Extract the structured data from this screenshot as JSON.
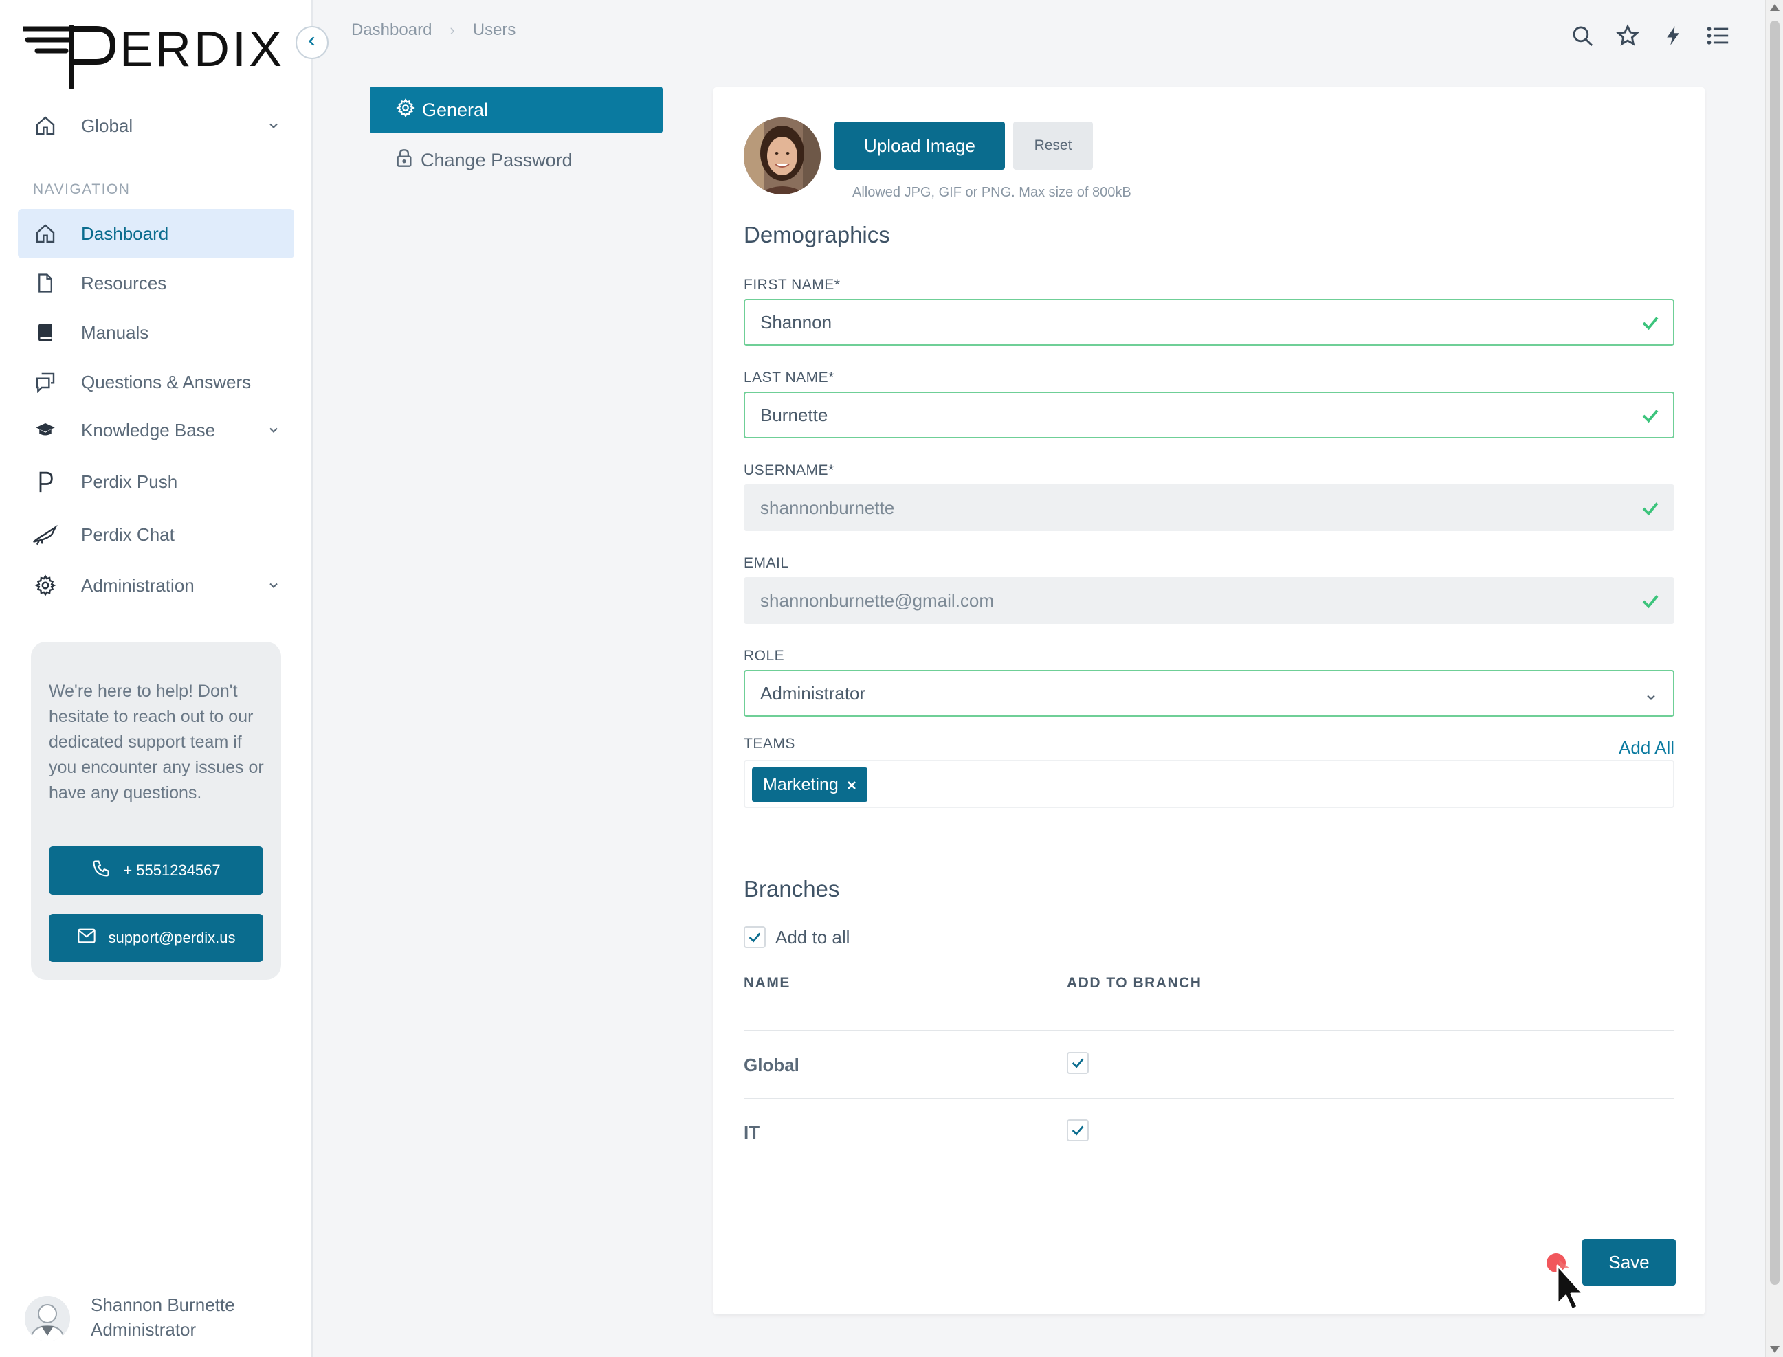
{
  "brand": {
    "logo_text": "PERDIX"
  },
  "sidebar": {
    "scope": {
      "label": "Global"
    },
    "nav_heading": "NAVIGATION",
    "items": [
      {
        "label": "Dashboard",
        "icon": "home-icon",
        "active": true
      },
      {
        "label": "Resources",
        "icon": "file-icon"
      },
      {
        "label": "Manuals",
        "icon": "book-icon"
      },
      {
        "label": "Questions & Answers",
        "icon": "chat-icon"
      },
      {
        "label": "Knowledge Base",
        "icon": "graduation-cap-icon",
        "expandable": true
      },
      {
        "label": "Perdix Push",
        "icon": "perdix-push-icon"
      },
      {
        "label": "Perdix Chat",
        "icon": "bird-icon"
      },
      {
        "label": "Administration",
        "icon": "gear-icon",
        "expandable": true
      }
    ],
    "help": {
      "text": "We're here to help! Don't hesitate to reach out to our dedicated support team if you encounter any issues or have any questions.",
      "phone": "+ 5551234567",
      "email": "support@perdix.us"
    },
    "user": {
      "name": "Shannon Burnette",
      "role": "Administrator"
    }
  },
  "breadcrumb": [
    "Dashboard",
    "Users"
  ],
  "subnav": {
    "general": "General",
    "change_password": "Change Password"
  },
  "profile": {
    "upload_label": "Upload Image",
    "reset_label": "Reset",
    "hint": "Allowed JPG, GIF or PNG. Max size of 800kB"
  },
  "demographics": {
    "title": "Demographics",
    "first_name": {
      "label": "FIRST NAME*",
      "value": "Shannon"
    },
    "last_name": {
      "label": "LAST NAME*",
      "value": "Burnette"
    },
    "username": {
      "label": "USERNAME*",
      "value": "shannonburnette"
    },
    "email": {
      "label": "EMAIL",
      "value": "shannonburnette@gmail.com"
    },
    "role": {
      "label": "ROLE",
      "value": "Administrator"
    },
    "teams": {
      "label": "TEAMS",
      "add_all": "Add All",
      "chips": [
        "Marketing"
      ]
    }
  },
  "branches": {
    "title": "Branches",
    "add_to_all": "Add to all",
    "columns": [
      "NAME",
      "ADD TO BRANCH"
    ],
    "rows": [
      {
        "name": "Global",
        "checked": true
      },
      {
        "name": "IT",
        "checked": true
      }
    ]
  },
  "actions": {
    "save": "Save"
  },
  "colors": {
    "primary": "#0a6c8e",
    "valid": "#6fcf97",
    "active_bg": "#e0ecfb"
  }
}
